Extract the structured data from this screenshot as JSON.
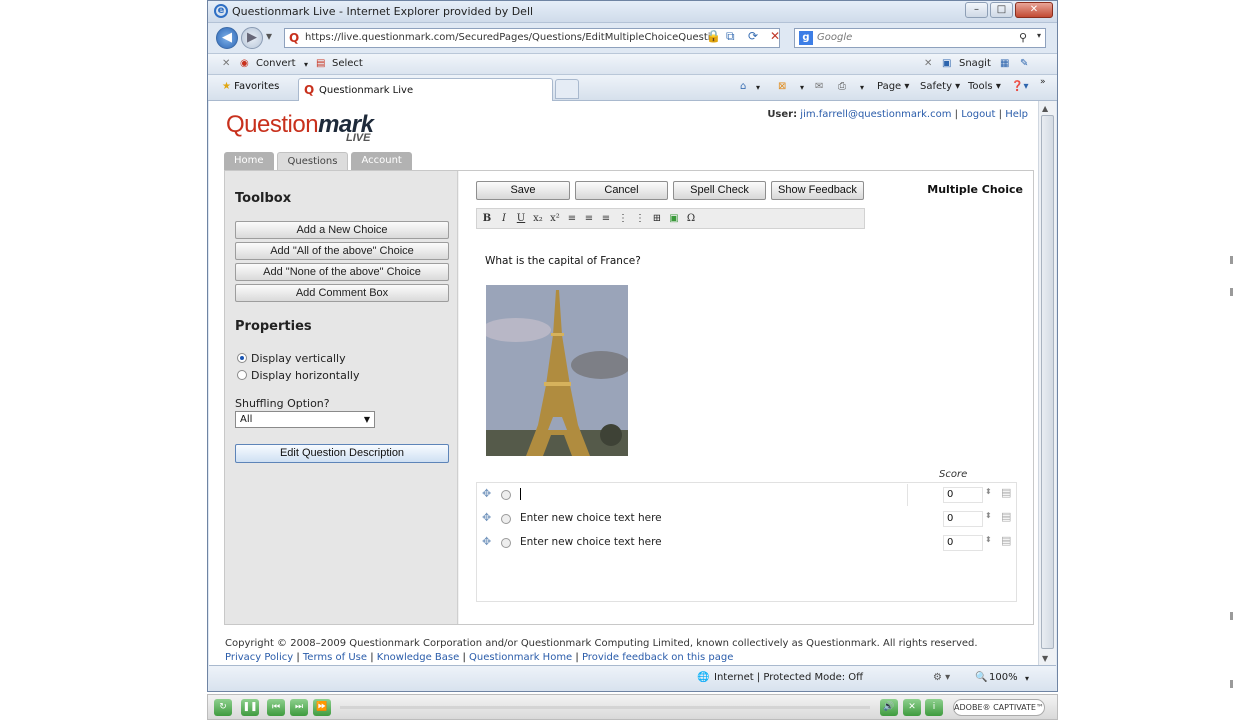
{
  "window": {
    "title": "Questionmark Live - Internet Explorer provided by Dell"
  },
  "address": {
    "url": "https://live.questionmark.com/SecuredPages/Questions/EditMultipleChoiceQuesti"
  },
  "search": {
    "placeholder": "Google"
  },
  "toolbar": {
    "convert": "Convert",
    "select": "Select",
    "snagit": "Snagit"
  },
  "favorites": {
    "label": "Favorites",
    "tab": "Questionmark Live"
  },
  "commands": {
    "page": "Page",
    "safety": "Safety",
    "tools": "Tools"
  },
  "app": {
    "logo_main": "Question",
    "logo_bold": "mark",
    "logo_sub": "LIVE",
    "user_label": "User:",
    "user_email": "jim.farrell@questionmark.com",
    "logout": "Logout",
    "help": "Help",
    "tabs": [
      "Home",
      "Questions",
      "Account"
    ]
  },
  "toolbox": {
    "title": "Toolbox",
    "buttons": [
      "Add a New Choice",
      "Add \"All of the above\" Choice",
      "Add \"None of the above\" Choice",
      "Add Comment Box"
    ],
    "properties_title": "Properties",
    "display_vertical": "Display vertically",
    "display_horizontal": "Display horizontally",
    "shuffle_label": "Shuffling Option?",
    "shuffle_value": "All",
    "edit_description": "Edit Question Description"
  },
  "editor": {
    "save": "Save",
    "cancel": "Cancel",
    "spell": "Spell Check",
    "feedback": "Show Feedback",
    "type": "Multiple Choice",
    "format_icons": [
      "B",
      "I",
      "U",
      "x₂",
      "x²",
      "≡",
      "≡",
      "≡",
      "⋮",
      "⋮",
      "⊞",
      "▣",
      "Ω"
    ],
    "question": "What is the capital of France?",
    "score_label": "Score",
    "choices": [
      {
        "text": "",
        "score": "0"
      },
      {
        "text": "Enter new choice text here",
        "score": "0"
      },
      {
        "text": "Enter new choice text here",
        "score": "0"
      }
    ]
  },
  "footer": {
    "copyright": "Copyright © 2008–2009 Questionmark Corporation and/or Questionmark Computing Limited, known collectively as Questionmark. All rights reserved.",
    "links": [
      "Privacy Policy",
      "Terms of Use",
      "Knowledge Base",
      "Questionmark Home",
      "Provide feedback on this page"
    ]
  },
  "status": {
    "zone": "Internet | Protected Mode: Off",
    "zoom": "100%"
  },
  "player": {
    "brand": "ADOBE® CAPTIVATE™"
  }
}
